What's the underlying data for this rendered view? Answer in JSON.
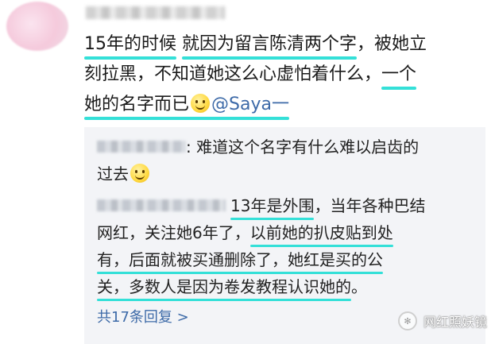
{
  "comment": {
    "line1_a": "15年的时候",
    "line1_b": " ",
    "line1_c": "就因为留言陈清两个字",
    "line1_d": "，被她立",
    "line2_a": "刻拉黑，不知道她这么心虚怕着什么，",
    "line2_b": "一个",
    "line3_a": "她的名字而已",
    "line3_mention": "@Saya一"
  },
  "reply1": {
    "line1": ": 难道这个名字有什么难以启齿的",
    "line2": "过去"
  },
  "reply2": {
    "l1_a": "13年是外围",
    "l1_b": "，当年各种巴结",
    "l2_a": "网红，关注她6年了，",
    "l2_b": "以前她的扒皮贴到处",
    "l3_a": "有，后面就被买通删除了，她红是买的公",
    "l4_a": "关，多数人是因为卷发教程认识她的",
    "l4_b": "。"
  },
  "more_replies": "共17条回复 >",
  "watermark": "网红照妖镜",
  "icons": {
    "emoji": "smiley-emoji-icon",
    "watermark": "wechat-channel-icon"
  },
  "colors": {
    "underline": "#34e0d8",
    "link": "#3d6aa8",
    "reply_bg": "#f3f4f7"
  }
}
